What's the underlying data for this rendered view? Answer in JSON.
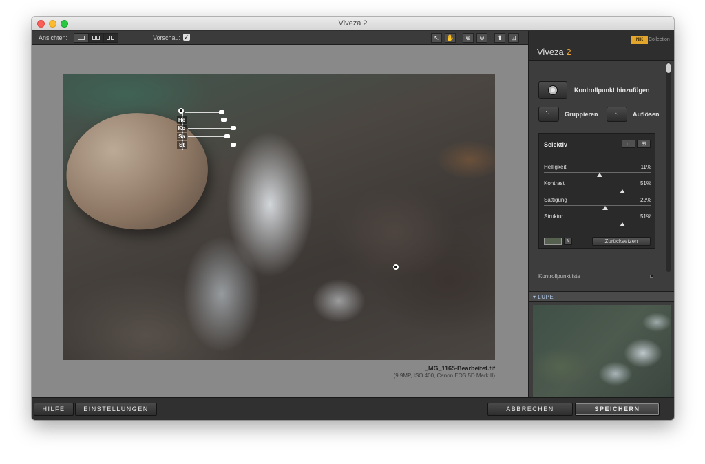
{
  "window": {
    "title": "Viveza 2"
  },
  "toolbar": {
    "views_label": "Ansichten:",
    "preview_label": "Vorschau:",
    "preview_checked": true
  },
  "image": {
    "file_name": "_MG_1165-Bearbeitet.tif",
    "file_info": "(9.9MP, ISO 400, Canon EOS 5D Mark II)"
  },
  "control_point": {
    "labels": [
      "He",
      "Ko",
      "Sa",
      "St"
    ]
  },
  "panel": {
    "app_name": "Viveza",
    "app_version": "2",
    "brand_badge": "NIK",
    "brand_suffix": "Collection",
    "add_control_point": "Kontrollpunkt hinzufügen",
    "group_label": "Gruppieren",
    "ungroup_label": "Auflösen",
    "selektiv": {
      "title": "Selektiv",
      "sliders": [
        {
          "name": "Helligkeit",
          "value": "11%",
          "position": 0.52
        },
        {
          "name": "Kontrast",
          "value": "51%",
          "position": 0.73
        },
        {
          "name": "Sättigung",
          "value": "22%",
          "position": 0.57
        },
        {
          "name": "Struktur",
          "value": "51%",
          "position": 0.73
        }
      ],
      "reset_label": "Zurücksetzen"
    },
    "control_point_list": "Kontrollpunktliste",
    "loupe_title": "LUPE"
  },
  "bottom": {
    "help": "HILFE",
    "settings": "EINSTELLUNGEN",
    "cancel": "ABBRECHEN",
    "save": "SPEICHERN"
  },
  "colors": {
    "accent_orange": "#f0a533",
    "panel_bg": "#3d3d3d",
    "canvas_bg": "#898989"
  }
}
